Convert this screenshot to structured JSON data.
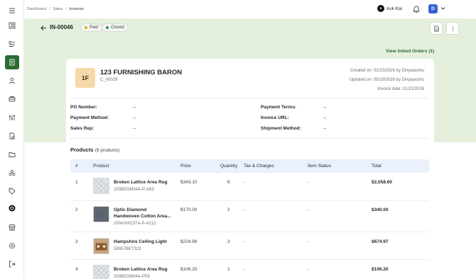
{
  "breadcrumb": {
    "items": [
      "Dashboard",
      "Sales",
      "Invoices"
    ],
    "separator": "/"
  },
  "topbar": {
    "ask_label": "Ask Kai",
    "avatar_initial": "D"
  },
  "invoice": {
    "id": "IN-00046",
    "status_badges": [
      {
        "label": "Paid",
        "color": "#e0b400"
      },
      {
        "label": "Closed",
        "color": "#2e8b57"
      }
    ],
    "linked_orders_label": "View linked Orders (1)"
  },
  "customer": {
    "monogram": "1F",
    "name": "123 FURNISHING BARON",
    "code": "C_00028",
    "created": "Created on: 01/23/2026 by Divyaanshu",
    "updated": "Updated on: 05/19/2026 by Divyaanshu",
    "invoice_date": "Invoice date: 01/23/2026"
  },
  "fields": {
    "po_number_label": "PO Number:",
    "po_number_value": "--",
    "payment_method_label": "Payment Method:",
    "payment_method_value": "--",
    "sales_rep_label": "Sales Rep:",
    "sales_rep_value": "--",
    "payment_terms_label": "Payment Terms:",
    "payment_terms_value": "--",
    "invoice_url_label": "Invoice URL:",
    "invoice_url_value": "--",
    "shipment_method_label": "Shipment Method:",
    "shipment_method_value": "--"
  },
  "products": {
    "title": "Products",
    "count": "(9 products)",
    "columns": [
      "#",
      "Product",
      "Price",
      "Quantity",
      "Tax & Charges",
      "Item Status",
      "Total"
    ],
    "rows": [
      {
        "num": "1",
        "name": "Broken Lattice Area Rug",
        "name2": "",
        "sku": "200BDSM04A-P-A63",
        "price": "$343.10",
        "qty": "6",
        "tax": "-",
        "status": "-",
        "total": "$2,058.60"
      },
      {
        "num": "2",
        "name": "Optic Diamond",
        "name2": "Handwoven Cotton Area...",
        "sku": "200ASHC07A-P-A212",
        "price": "$170.00",
        "qty": "2",
        "tax": "-",
        "status": "-",
        "total": "$340.00"
      },
      {
        "num": "3",
        "name": "Hampshire Ceiling Light",
        "name2": "",
        "sku": "59057BKT323",
        "price": "$224.99",
        "qty": "3",
        "tax": "-",
        "status": "-",
        "total": "$674.97"
      },
      {
        "num": "4",
        "name": "Broken Lattice Area Rug",
        "name2": "",
        "sku": "200BDSM04A-P59",
        "price": "$106.20",
        "qty": "1",
        "tax": "-",
        "status": "-",
        "total": "$106.20"
      }
    ]
  },
  "icons": [
    "menu-icon",
    "dashboard-icon",
    "list-icon",
    "invoice-icon",
    "user-icon",
    "orders-icon",
    "sliders-icon",
    "file-dollar-icon",
    "folder-icon",
    "shapes-icon",
    "tag-icon",
    "kai-icon",
    "store-icon",
    "settings-icon",
    "logout-icon"
  ],
  "colors": {
    "accent": "#2e6b34",
    "panel_bg": "#e5f0dc",
    "table_header": "#eaf1fd",
    "avatar": "#3563d6"
  }
}
